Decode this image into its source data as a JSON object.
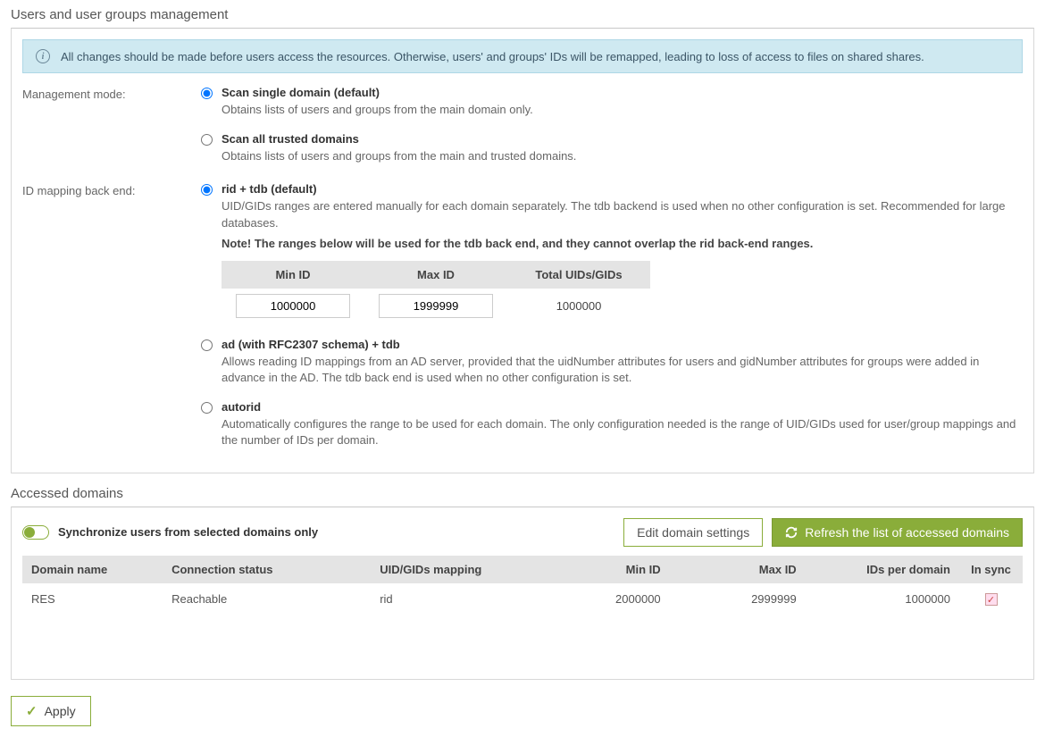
{
  "section1_title": "Users and user groups management",
  "info_banner": "All changes should be made before users access the resources. Otherwise, users' and groups' IDs will be remapped, leading to loss of access to files on shared shares.",
  "mgmt_label": "Management mode:",
  "mgmt": {
    "opt1_title": "Scan single domain (default)",
    "opt1_desc": "Obtains lists of users and groups from the main domain only.",
    "opt2_title": "Scan all trusted domains",
    "opt2_desc": "Obtains lists of users and groups from the main and trusted domains."
  },
  "idmap_label": "ID mapping back end:",
  "idmap": {
    "opt1_title": "rid + tdb (default)",
    "opt1_desc": "UID/GIDs ranges are entered manually for each domain separately. The tdb backend is used when no other configuration is set. Recommended for large databases.",
    "opt1_note": "Note! The ranges below will be used for the tdb back end, and they cannot overlap the rid back-end ranges.",
    "range_table": {
      "h1": "Min ID",
      "h2": "Max ID",
      "h3": "Total UIDs/GIDs",
      "min": "1000000",
      "max": "1999999",
      "total": "1000000"
    },
    "opt2_title": "ad (with RFC2307 schema) + tdb",
    "opt2_desc": "Allows reading ID mappings from an AD server, provided that the uidNumber attributes for users and gidNumber attributes for groups were added in advance in the AD. The tdb back end is used when no other configuration is set.",
    "opt3_title": "autorid",
    "opt3_desc": "Automatically configures the range to be used for each domain. The only configuration needed is the range of UID/GIDs used for user/group mappings and the number of IDs per domain."
  },
  "section2_title": "Accessed domains",
  "toggle_label": "Synchronize users from selected domains only",
  "btn_edit": "Edit domain settings",
  "btn_refresh": "Refresh the list of accessed domains",
  "dom_headers": {
    "name": "Domain name",
    "conn": "Connection status",
    "map": "UID/GIDs mapping",
    "min": "Min ID",
    "max": "Max ID",
    "per": "IDs per domain",
    "sync": "In sync"
  },
  "dom_row": {
    "name": "RES",
    "conn": "Reachable",
    "map": "rid",
    "min": "2000000",
    "max": "2999999",
    "per": "1000000"
  },
  "apply_label": "Apply"
}
